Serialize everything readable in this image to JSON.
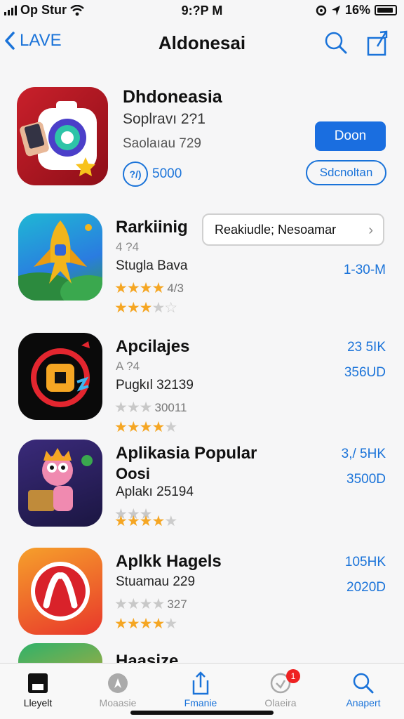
{
  "status": {
    "carrier": "Op Stur",
    "time": "9:?P M",
    "battery": "16%"
  },
  "nav": {
    "back_label": "LAVE",
    "title": "Aldonesai"
  },
  "featured": {
    "title": "Dhdoneasia",
    "subtitle": "Soplravı 2?1",
    "meta": "Saolaıau 729",
    "rating_badge": "?/)",
    "rating_count": "5000",
    "open_label": "Doon",
    "secondary_label": "Sdcnoltan"
  },
  "pill": {
    "label": "Reakiudle; Nesoamar"
  },
  "rows": [
    {
      "name": "Rarkiinig",
      "line2": "4 ?4",
      "line3": "Stugla Bava",
      "stars1_note": "4/3",
      "val1": "1-30-M",
      "val2": ""
    },
    {
      "name": "Apcilajes",
      "line2": "A ?4",
      "line3": "Pugkıl 32139",
      "stars1_note": "30011",
      "val1": "23 5IK",
      "val2": "356UD"
    },
    {
      "name": "Aplikasia Popular",
      "name2": "Oosi",
      "line3": "Aplakı 25194",
      "stars1_note": "",
      "val1": "3,/ 5HK",
      "val2": "3500D"
    },
    {
      "name": "Aplkk Hagels",
      "line3": "Stuamau 229",
      "stars1_note": "327",
      "val1": "105HK",
      "val2": "2020D"
    },
    {
      "name": "Haasize"
    }
  ],
  "tabs": [
    {
      "label": "Lleyelt",
      "icon": "home-icon"
    },
    {
      "label": "Moaasie",
      "icon": "compass-icon"
    },
    {
      "label": "Fmanie",
      "icon": "share-icon"
    },
    {
      "label": "Olaeira",
      "icon": "chat-icon",
      "badge": "1"
    },
    {
      "label": "Anapert",
      "icon": "search-icon"
    }
  ],
  "colors": {
    "accent": "#1a73d9",
    "star": "#f5a623",
    "featured_icon": "#c9202b"
  }
}
